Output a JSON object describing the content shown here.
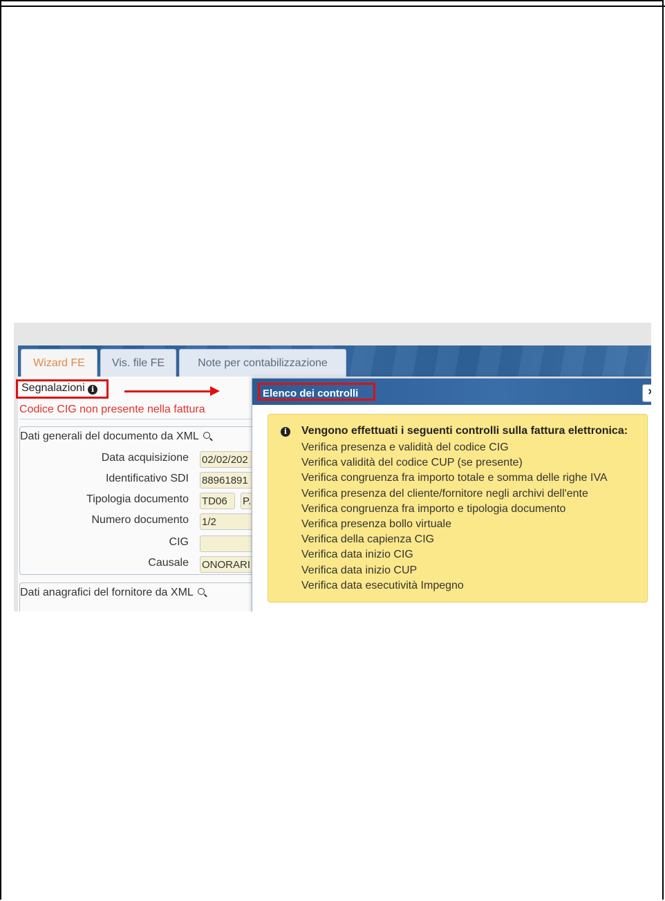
{
  "tabs": [
    {
      "label": "Wizard FE",
      "active": true
    },
    {
      "label": "Vis. file FE",
      "active": false
    },
    {
      "label": "Note per contabilizzazione",
      "active": false
    }
  ],
  "segnalazioni": {
    "label": "Segnalazioni",
    "icon": "info-icon",
    "error": "Codice CIG non presente nella fattura"
  },
  "general": {
    "title": "Dati generali del documento da XML",
    "fields": [
      {
        "label": "Data acquisizione",
        "value": "02/02/202"
      },
      {
        "label": "Identificativo SDI",
        "value": "88961891"
      },
      {
        "label": "Tipologia documento",
        "value": "TD06",
        "value2": "P."
      },
      {
        "label": "Numero documento",
        "value": "1/2"
      },
      {
        "label": "CIG",
        "value": ""
      },
      {
        "label": "Causale",
        "value": "ONORARI"
      }
    ]
  },
  "supplier": {
    "title": "Dati anagrafici del fornitore da XML"
  },
  "dialog": {
    "title": "Elenco dei controlli",
    "close_label": "×",
    "heading": "Vengono effettuati i seguenti controlli sulla fattura elettronica:",
    "items": [
      "Verifica presenza e validità del codice CIG",
      "Verifica validità del codice CUP (se presente)",
      "Verifica congruenza fra importo totale e somma delle righe IVA",
      "Verifica presenza del cliente/fornitore negli archivi dell'ente",
      "Verifica congruenza fra importo e tipologia documento",
      "Verifica presenza bollo virtuale",
      "Verifica della capienza CIG",
      "Verifica data inizio CIG",
      "Verifica data inizio CUP",
      "Verifica data esecutività Impegno"
    ]
  },
  "colors": {
    "accent_red": "#e01010",
    "banner_blue": "#2d5f98",
    "alert_yellow": "#fbe88a",
    "error_text": "#e0322b"
  }
}
